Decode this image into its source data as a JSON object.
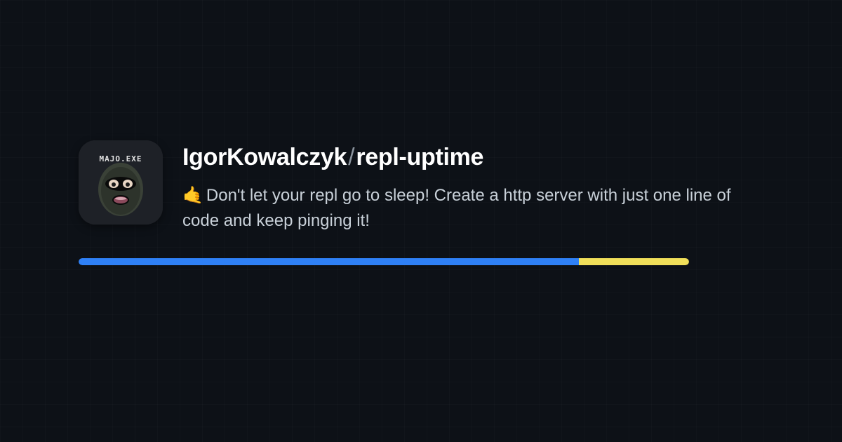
{
  "repo": {
    "owner": "IgorKowalczyk",
    "name": "repl-uptime",
    "description_emoji": "🤙",
    "description": "Don't let your repl go to sleep! Create a http server with just one line of code and keep pinging it!"
  },
  "avatar": {
    "label": "MAJO.EXE"
  },
  "progress": {
    "segment1_color": "#2f81f7",
    "segment1_percent": 82,
    "segment2_color": "#f1e05a",
    "segment2_percent": 18
  }
}
